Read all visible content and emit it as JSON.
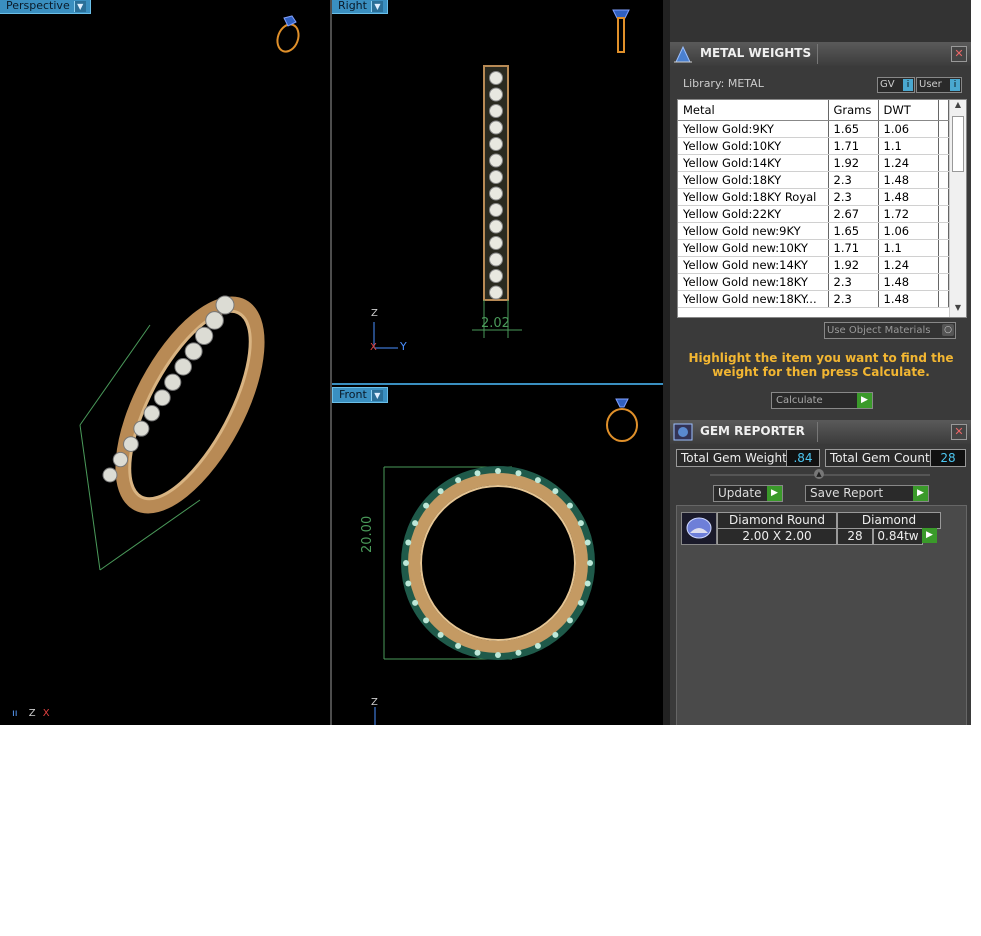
{
  "viewports": {
    "perspective": {
      "label": "Perspective"
    },
    "right": {
      "label": "Right",
      "dimension": "2.02",
      "axis_z": "Z",
      "axis_x": "X",
      "axis_y": "Y"
    },
    "front": {
      "label": "Front",
      "dimension": "20.00",
      "axis_z": "Z"
    },
    "perspective_axes": {
      "z": "Z",
      "x": "X"
    }
  },
  "metal_weights": {
    "title": "METAL WEIGHTS",
    "library_label": "Library: METAL",
    "gv_label": "GV",
    "user_label": "User",
    "columns": [
      "Metal",
      "Grams",
      "DWT"
    ],
    "rows": [
      {
        "metal": "Yellow Gold:9KY",
        "grams": "1.65",
        "dwt": "1.06"
      },
      {
        "metal": "Yellow Gold:10KY",
        "grams": "1.71",
        "dwt": "1.1"
      },
      {
        "metal": "Yellow Gold:14KY",
        "grams": "1.92",
        "dwt": "1.24"
      },
      {
        "metal": "Yellow Gold:18KY",
        "grams": "2.3",
        "dwt": "1.48"
      },
      {
        "metal": "Yellow Gold:18KY Royal",
        "grams": "2.3",
        "dwt": "1.48"
      },
      {
        "metal": "Yellow Gold:22KY",
        "grams": "2.67",
        "dwt": "1.72"
      },
      {
        "metal": "Yellow Gold new:9KY",
        "grams": "1.65",
        "dwt": "1.06"
      },
      {
        "metal": "Yellow Gold new:10KY",
        "grams": "1.71",
        "dwt": "1.1"
      },
      {
        "metal": "Yellow Gold new:14KY",
        "grams": "1.92",
        "dwt": "1.24"
      },
      {
        "metal": "Yellow Gold new:18KY",
        "grams": "2.3",
        "dwt": "1.48"
      },
      {
        "metal": "Yellow Gold new:18KY...",
        "grams": "2.3",
        "dwt": "1.48"
      }
    ],
    "use_object_materials": "Use Object Materials",
    "hint": "Highlight the item you want to find the weight for then press Calculate.",
    "calculate_label": "Calculate"
  },
  "gem_reporter": {
    "title": "GEM REPORTER",
    "total_gem_weight_label": "Total Gem Weight",
    "total_gem_weight_value": ".84",
    "total_gem_count_label": "Total Gem Count",
    "total_gem_count_value": "28",
    "update_label": "Update",
    "save_report_label": "Save Report",
    "gem": {
      "name": "Diamond Round",
      "type": "Diamond",
      "size": "2.00 X 2.00",
      "count": "28",
      "weight": "0.84tw"
    }
  },
  "colors": {
    "accent": "#3a8fc0",
    "gold": "#c9a06a",
    "hint_text": "#f2b632",
    "value_text": "#4cc6f0"
  }
}
